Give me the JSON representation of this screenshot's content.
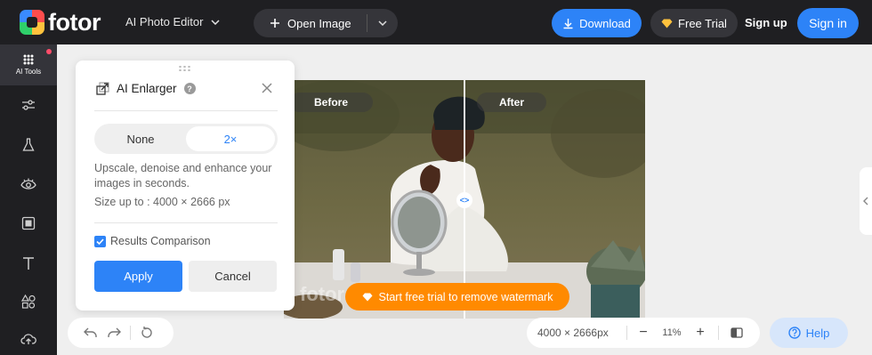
{
  "app": {
    "logo_text": "fotor"
  },
  "header": {
    "editor_menu": "AI Photo Editor",
    "open_image": "Open Image",
    "download": "Download",
    "free_trial": "Free Trial",
    "sign_up": "Sign up",
    "sign_in": "Sign in"
  },
  "sidebar": {
    "active_label": "AI Tools",
    "items": [
      "adjust-icon",
      "flask-icon",
      "eye-icon",
      "frame-icon",
      "text-icon",
      "elements-icon",
      "cloud-upload-icon"
    ]
  },
  "canvas": {
    "before_label": "Before",
    "after_label": "After",
    "watermark": "fotor",
    "trial_banner": "Start free trial to remove watermark",
    "compare_handle": "<>"
  },
  "panel": {
    "title": "AI Enlarger",
    "options": [
      "None",
      "2×"
    ],
    "selected_option": "2×",
    "description": "Upscale, denoise and enhance your images in seconds.",
    "size_text": "Size up to : 4000 × 2666 px",
    "compare_label": "Results Comparison",
    "compare_checked": true,
    "apply": "Apply",
    "cancel": "Cancel"
  },
  "footer": {
    "dimensions": "4000 × 2666px",
    "zoom": "11%",
    "help": "Help"
  },
  "colors": {
    "accent": "#2d83f7",
    "topbar": "#1f1f22",
    "banner": "#ff8a00"
  }
}
